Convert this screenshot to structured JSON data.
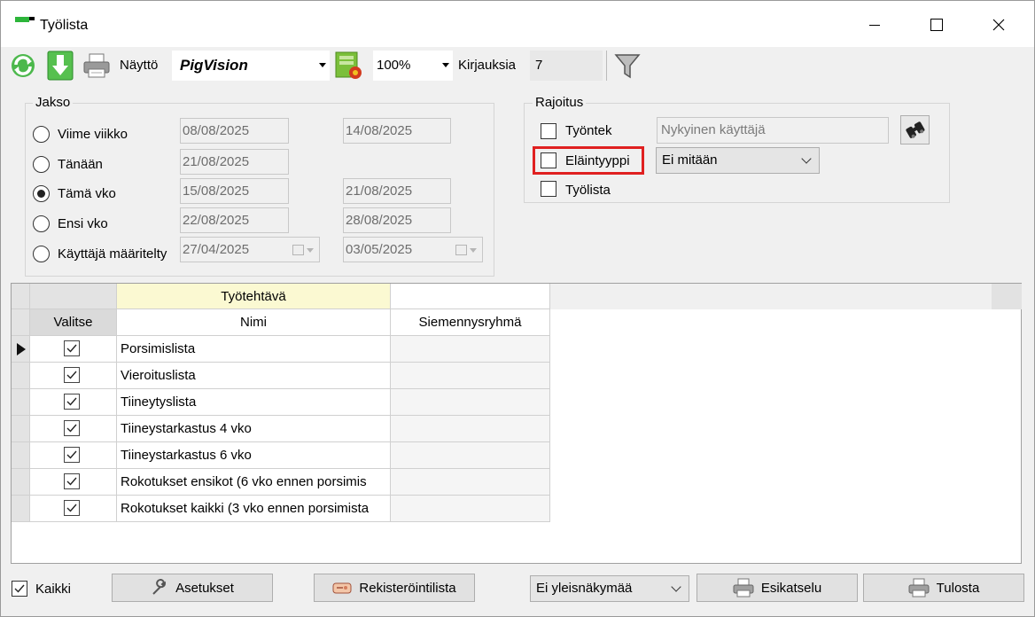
{
  "window": {
    "title": "Työlista"
  },
  "toolbar": {
    "display_label": "Näyttö",
    "display_value": "PigVision",
    "zoom_value": "100%",
    "records_label": "Kirjauksia",
    "records_value": "7"
  },
  "jakso": {
    "title": "Jakso",
    "options": [
      {
        "label": "Viime viikko",
        "from": "08/08/2025",
        "to": "14/08/2025",
        "selected": false
      },
      {
        "label": "Tänään",
        "from": "21/08/2025",
        "to": "",
        "selected": false
      },
      {
        "label": "Tämä vko",
        "from": "15/08/2025",
        "to": "21/08/2025",
        "selected": true
      },
      {
        "label": "Ensi vko",
        "from": "22/08/2025",
        "to": "28/08/2025",
        "selected": false
      },
      {
        "label": "Käyttäjä määritelty",
        "from": "27/04/2025",
        "to": "03/05/2025",
        "selected": false
      }
    ]
  },
  "rajoitus": {
    "title": "Rajoitus",
    "employee_label": "Työntek",
    "employee_value": "Nykyinen käyttäjä",
    "animal_type_label": "Eläintyyppi",
    "animal_type_value": "Ei mitään",
    "worklist_label": "Työlista"
  },
  "grid": {
    "group_header": "Työtehtävä",
    "col_select": "Valitse",
    "col_name": "Nimi",
    "col_group": "Siemennysryhmä",
    "rows": [
      {
        "name": "Porsimislista",
        "group": "",
        "checked": true
      },
      {
        "name": "Vieroituslista",
        "group": "",
        "checked": true
      },
      {
        "name": "Tiineytyslista",
        "group": "",
        "checked": true
      },
      {
        "name": "Tiineystarkastus 4 vko",
        "group": "",
        "checked": true
      },
      {
        "name": "Tiineystarkastus 6 vko",
        "group": "",
        "checked": true
      },
      {
        "name": "Rokotukset ensikot (6 vko ennen porsimis",
        "group": "",
        "checked": true
      },
      {
        "name": "Rokotukset kaikki (3 vko ennen porsimista",
        "group": "",
        "checked": true
      }
    ]
  },
  "bottom": {
    "all_label": "Kaikki",
    "settings_label": "Asetukset",
    "register_list_label": "Rekisteröintilista",
    "view_value": "Ei yleisnäkymää",
    "preview_label": "Esikatselu",
    "print_label": "Tulosta"
  },
  "colors": {
    "highlight": "#e02020",
    "grid_group_header": "#fbf9d2"
  }
}
